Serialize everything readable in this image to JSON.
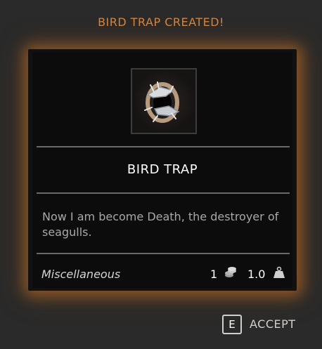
{
  "banner": {
    "text": "BIRD TRAP CREATED!"
  },
  "item": {
    "icon": "bird-trap-icon",
    "name": "BIRD TRAP",
    "description": "Now I am become Death, the destroyer of seagulls.",
    "category": "Miscellaneous",
    "value": "1",
    "value_icon": "coins-icon",
    "weight": "1.0",
    "weight_icon": "weight-icon"
  },
  "accept": {
    "key": "E",
    "label": "ACCEPT"
  },
  "colors": {
    "accent": "#d6853d",
    "panel": "#0c0c0c",
    "background": "#2a2a2a"
  }
}
